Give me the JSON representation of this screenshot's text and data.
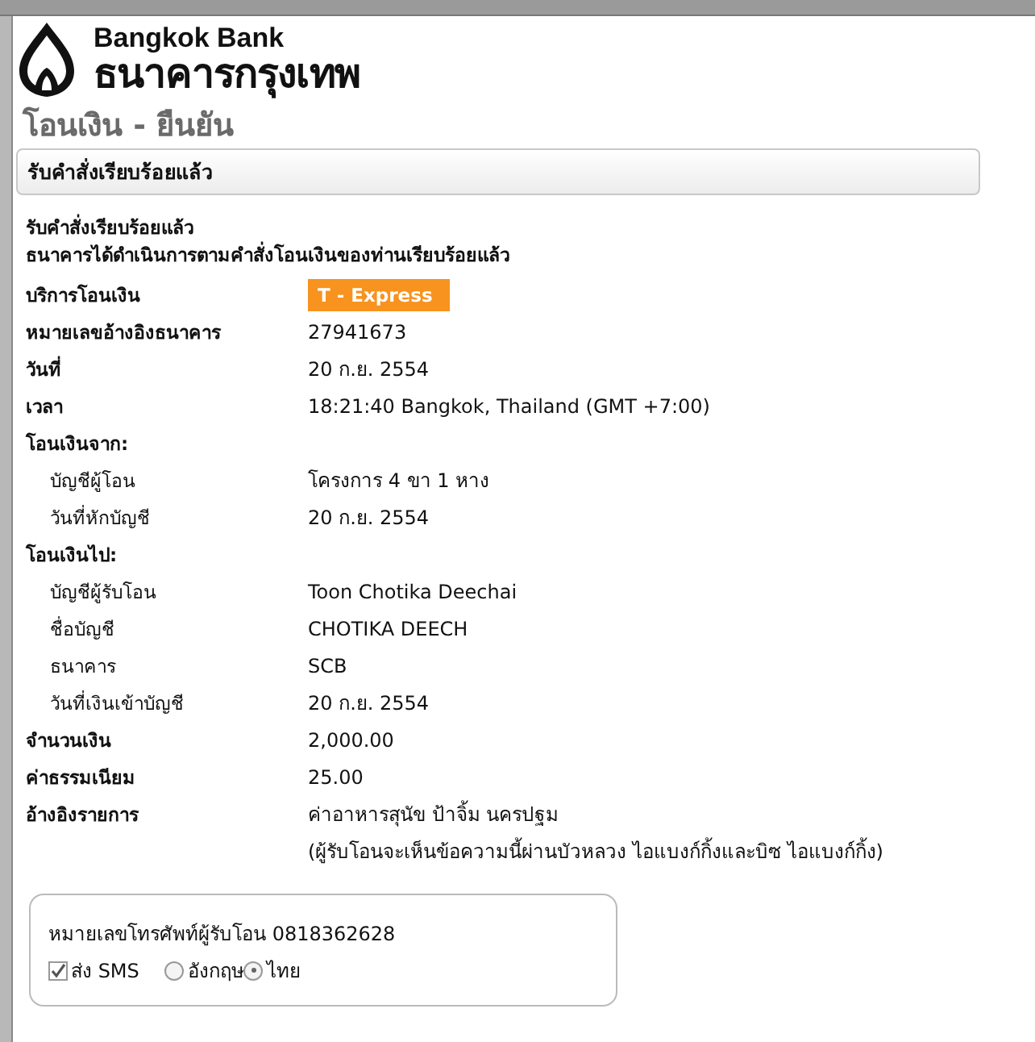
{
  "logo": {
    "name_en": "Bangkok Bank",
    "name_th": "ธนาคารกรุงเทพ"
  },
  "page_title": "โอนเงิน - ยืนยัน",
  "panel_heading": "รับคำสั่งเรียบร้อยแล้ว",
  "messages": [
    "รับคำสั่งเรียบร้อยแล้ว",
    "ธนาคารได้ดำเนินการตามคำสั่งโอนเงินของท่านเรียบร้อยแล้ว"
  ],
  "rows": [
    {
      "kind": "badge",
      "label": "บริการโอนเงิน",
      "value": "T - Express"
    },
    {
      "kind": "field",
      "label": "หมายเลขอ้างอิงธนาคาร",
      "value": "27941673"
    },
    {
      "kind": "field",
      "label": "วันที่",
      "value": "20 ก.ย. 2554"
    },
    {
      "kind": "field",
      "label": "เวลา",
      "value": "18:21:40 Bangkok, Thailand (GMT +7:00)"
    },
    {
      "kind": "section",
      "label": "โอนเงินจาก:",
      "children": [
        {
          "kind": "field",
          "label": "บัญชีผู้โอน",
          "value": "โครงการ 4 ขา 1 หาง"
        },
        {
          "kind": "field",
          "label": "วันที่หักบัญชี",
          "value": "20 ก.ย. 2554"
        }
      ]
    },
    {
      "kind": "section",
      "label": "โอนเงินไป:",
      "children": [
        {
          "kind": "field",
          "label": "บัญชีผู้รับโอน",
          "value": "Toon Chotika Deechai"
        },
        {
          "kind": "field",
          "label": "ชื่อบัญชี",
          "value": "CHOTIKA DEECH"
        },
        {
          "kind": "field",
          "label": "ธนาคาร",
          "value": "SCB"
        },
        {
          "kind": "field",
          "label": "วันที่เงินเข้าบัญชี",
          "value": "20 ก.ย. 2554"
        }
      ]
    },
    {
      "kind": "field",
      "label": "จำนวนเงิน",
      "value": "2,000.00"
    },
    {
      "kind": "field",
      "label": "ค่าธรรมเนียม",
      "value": "25.00"
    },
    {
      "kind": "field",
      "label": "อ้างอิงรายการ",
      "value": "ค่าอาหารสุนัข ป้าจิ้ม นครปฐม",
      "note": "(ผู้รับโอนจะเห็นข้อความนี้ผ่านบัวหลวง ไอแบงก์กิ้งและบิซ ไอแบงก์กิ้ง)"
    }
  ],
  "sms": {
    "phone_text": "หมายเลขโทรศัพท์ผู้รับโอน 0818362628",
    "send": {
      "label": "ส่ง SMS",
      "checked": true
    },
    "languages": [
      {
        "label": "อังกฤษ",
        "selected": false
      },
      {
        "label": "ไทย",
        "selected": true
      }
    ]
  }
}
